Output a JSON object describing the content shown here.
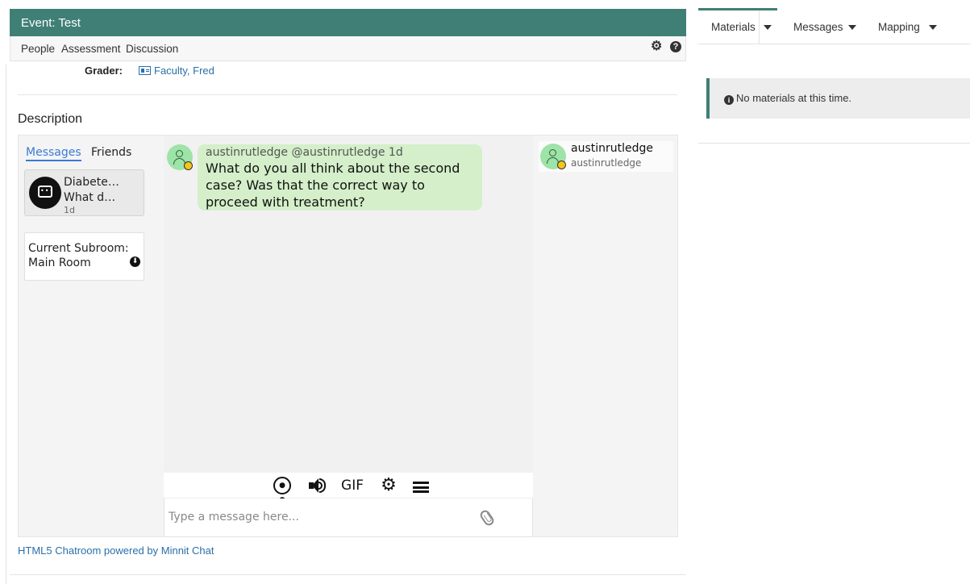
{
  "event": {
    "title": "Event: Test",
    "nav": [
      "People",
      "Assessment",
      "Discussion"
    ],
    "icons": [
      "gear-icon",
      "help-icon"
    ]
  },
  "grader": {
    "label": "Grader:",
    "name": "Faculty, Fred"
  },
  "description": {
    "title": "Description"
  },
  "chat": {
    "tabs": {
      "messages": "Messages",
      "friends": "Friends"
    },
    "conversation": {
      "title_line1": "Diabete…",
      "title_line2": "What d…",
      "time": "1d"
    },
    "subroom": {
      "line1": "Current Subroom:",
      "line2": "Main Room"
    },
    "message": {
      "meta": "austinrutledge @austinrutledge 1d",
      "text": "What do you all think about the second case? Was that the correct way to proceed with treatment?"
    },
    "toolbar": {
      "gif": "GIF"
    },
    "input": {
      "placeholder": "Type a message here..."
    },
    "user": {
      "name": "austinrutledge",
      "handle": "austinrutledge"
    },
    "powered_by": "HTML5 Chatroom powered by Minnit Chat",
    "colors": {
      "accent": "#3a7bd5",
      "bubble": "#d4efc9",
      "avatar": "#9ee3a7",
      "status": "#f5c518"
    }
  },
  "right": {
    "tabs": [
      "Materials",
      "Messages",
      "Mapping"
    ],
    "alert": "No materials at this time."
  },
  "theme": {
    "brand": "#3f7f76",
    "link": "#2a6fa8"
  }
}
